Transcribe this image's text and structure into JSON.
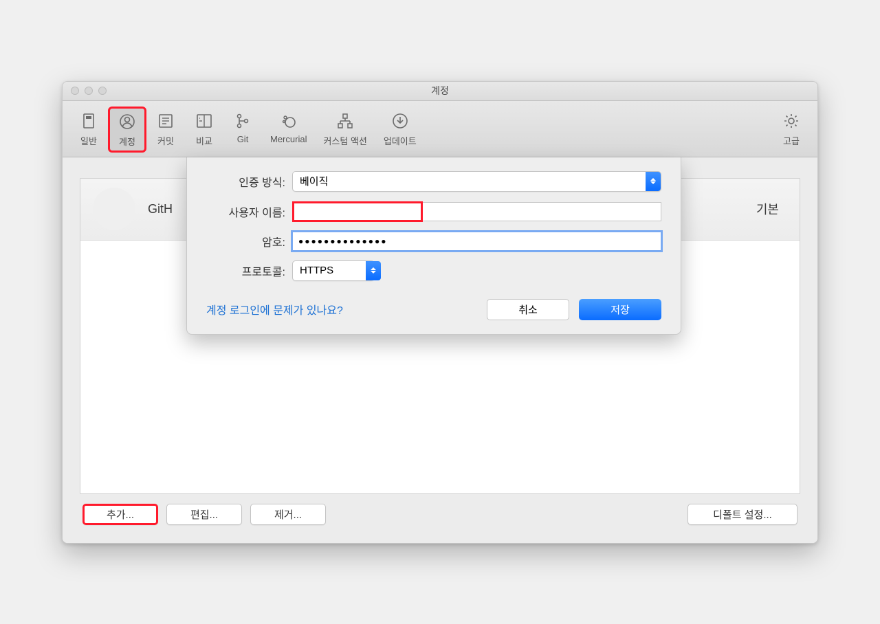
{
  "window": {
    "title": "계정"
  },
  "toolbar": {
    "items": [
      {
        "label": "일반",
        "icon": "general"
      },
      {
        "label": "계정",
        "icon": "account",
        "active": true
      },
      {
        "label": "커밋",
        "icon": "commit"
      },
      {
        "label": "비교",
        "icon": "diff"
      },
      {
        "label": "Git",
        "icon": "git"
      },
      {
        "label": "Mercurial",
        "icon": "mercurial"
      },
      {
        "label": "커스텀 액션",
        "icon": "custom"
      },
      {
        "label": "업데이트",
        "icon": "update"
      }
    ],
    "advanced": {
      "label": "고급",
      "icon": "gear"
    }
  },
  "accounts": {
    "row": {
      "name": "GitH",
      "badge": "기본"
    }
  },
  "buttons": {
    "add": "추가...",
    "edit": "편집...",
    "remove": "제거...",
    "default": "디폴트 설정..."
  },
  "sheet": {
    "auth_label": "인증 방식:",
    "auth_value": "베이직",
    "username_label": "사용자 이름:",
    "username_value": "",
    "password_label": "암호:",
    "password_value": "●●●●●●●●●●●●●●",
    "protocol_label": "프로토콜:",
    "protocol_value": "HTTPS",
    "help_link": "계정 로그인에 문제가 있나요?",
    "cancel": "취소",
    "save": "저장"
  }
}
